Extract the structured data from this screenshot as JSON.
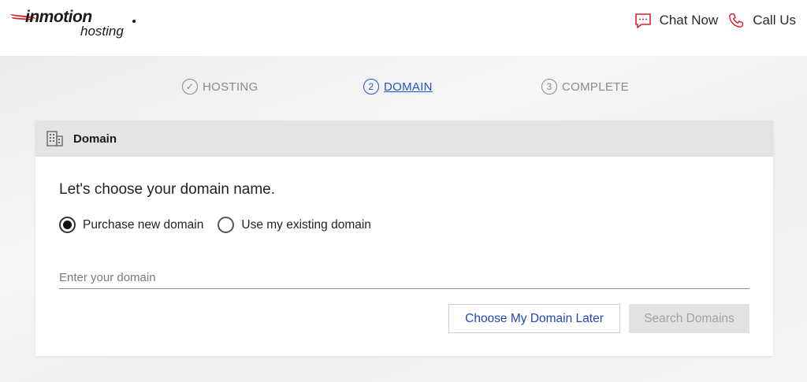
{
  "brand": {
    "name": "inmotion",
    "sub": "hosting"
  },
  "header": {
    "chat_label": "Chat Now",
    "call_label": "Call Us",
    "accent": "#d22630"
  },
  "stepper": {
    "steps": [
      {
        "number": "✓",
        "label": "HOSTING",
        "state": "done"
      },
      {
        "number": "2",
        "label": "DOMAIN",
        "state": "active"
      },
      {
        "number": "3",
        "label": "COMPLETE",
        "state": "upcoming"
      }
    ],
    "active_color": "#2255cc"
  },
  "card": {
    "title": "Domain",
    "prompt": "Let's choose your domain name.",
    "options": [
      {
        "label": "Purchase new domain",
        "selected": true
      },
      {
        "label": "Use my existing domain",
        "selected": false
      }
    ],
    "input": {
      "placeholder": "Enter your domain",
      "value": ""
    },
    "buttons": {
      "later": "Choose My Domain Later",
      "search": "Search Domains"
    }
  }
}
